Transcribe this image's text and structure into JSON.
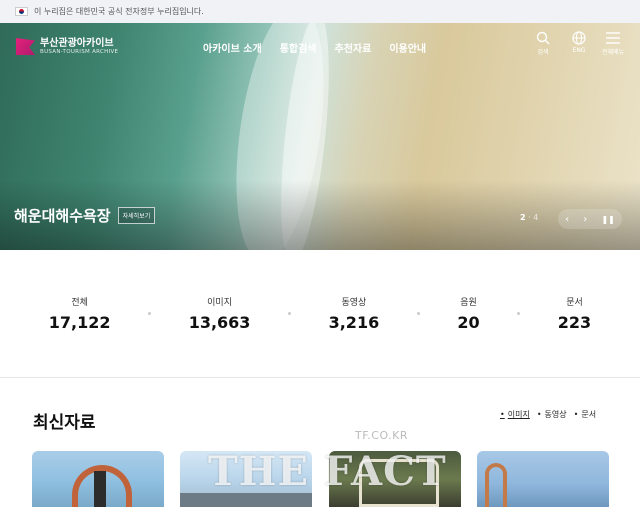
{
  "gov_banner": {
    "text": "이 누리집은 대한민국 공식 전자정부 누리집입니다."
  },
  "logo": {
    "name_ko": "부산관광아카이브",
    "name_en": "BUSAN-TOURISM ARCHIVE"
  },
  "nav": {
    "items": [
      "아카이브 소개",
      "통합검색",
      "추천자료",
      "이용안내"
    ]
  },
  "utility": {
    "search": "검색",
    "language": "ENG",
    "menu": "전체메뉴"
  },
  "hero": {
    "title": "해운대해수욕장",
    "more_label": "자세히보기",
    "current_page": "2",
    "total_pages": "4"
  },
  "stats": [
    {
      "label": "전체",
      "value": "17,122"
    },
    {
      "label": "이미지",
      "value": "13,663"
    },
    {
      "label": "동영상",
      "value": "3,216"
    },
    {
      "label": "음원",
      "value": "20"
    },
    {
      "label": "문서",
      "value": "223"
    }
  ],
  "latest": {
    "title": "최신자료",
    "tabs": [
      "이미지",
      "동영상",
      "문서"
    ],
    "active_tab": "이미지"
  },
  "watermark": {
    "small": "TF.CO.KR",
    "big": "THE FACT"
  },
  "colors": {
    "brand": "#e4227a",
    "sea": "#3f8570",
    "sand": "#e0d3ad"
  }
}
